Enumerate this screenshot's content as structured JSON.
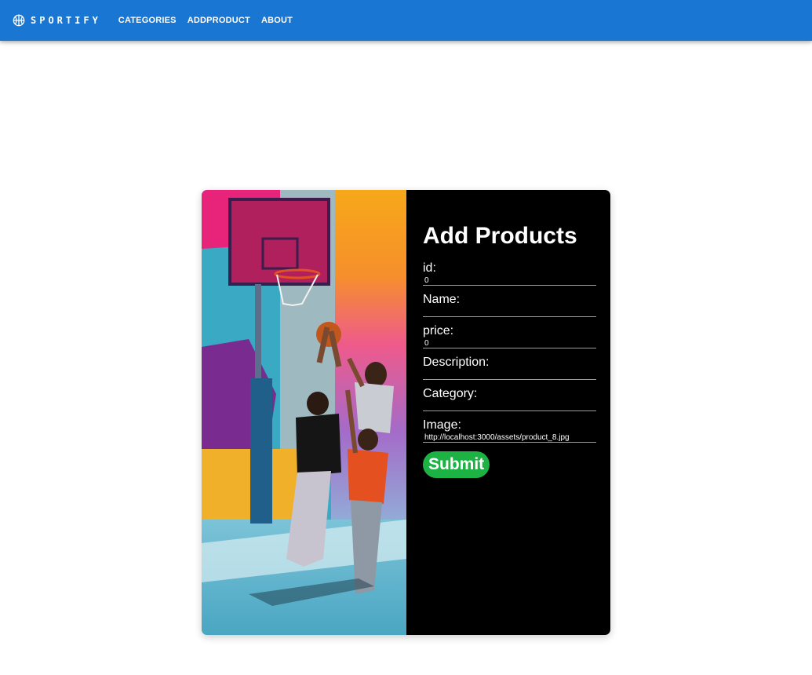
{
  "header": {
    "brand": "SPORTIFY",
    "nav": [
      {
        "label": "CATEGORIES"
      },
      {
        "label": "ADDPRODUCT"
      },
      {
        "label": "ABOUT"
      }
    ]
  },
  "form": {
    "title": "Add Products",
    "fields": [
      {
        "label": "id:",
        "value": "0"
      },
      {
        "label": "Name:",
        "value": ""
      },
      {
        "label": "price:",
        "value": "0"
      },
      {
        "label": "Description:",
        "value": ""
      },
      {
        "label": "Category:",
        "value": ""
      },
      {
        "label": "Image:",
        "value": "http://localhost:3000/assets/product_8.jpg"
      }
    ],
    "submit_label": "Submit"
  },
  "colors": {
    "appbar": "#1976d2",
    "panel": "#000000",
    "submit": "#1db344"
  }
}
